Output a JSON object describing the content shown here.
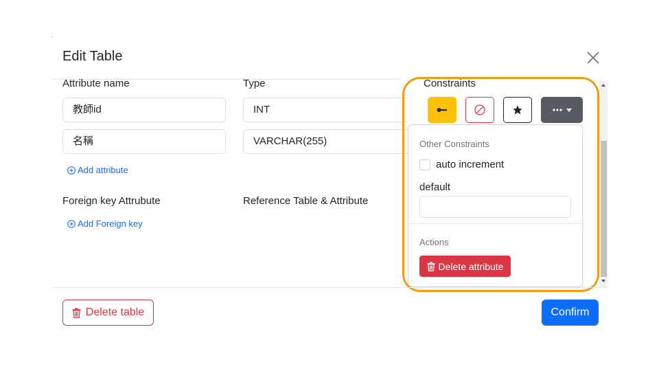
{
  "modal": {
    "title": "Edit Table",
    "close_icon": "close-icon"
  },
  "columns": {
    "attribute_name": "Attribute name",
    "type": "Type",
    "constraints": "Constraints"
  },
  "attributes": [
    {
      "name": "教師id",
      "type": "INT"
    },
    {
      "name": "名稱",
      "type": "VARCHAR(255)"
    }
  ],
  "add_attribute": "Add attribute",
  "foreign": {
    "label": "Foreign key Attrubute",
    "reference_label": "Reference Table & Attribute",
    "add_label": "Add Foreign key"
  },
  "constraint_buttons": {
    "primary_key_icon": "key-icon",
    "not_null_icon": "ban-icon",
    "unique_icon": "star-icon",
    "more_icon": "ellipsis-icon"
  },
  "dropdown": {
    "other_constraints_label": "Other Constraints",
    "auto_increment_label": "auto increment",
    "auto_increment_checked": false,
    "default_label": "default",
    "default_value": "",
    "actions_label": "Actions",
    "delete_attribute_label": "Delete attribute"
  },
  "footer": {
    "delete_table_label": "Delete table",
    "confirm_label": "Confirm"
  },
  "colors": {
    "primary": "#0d6efd",
    "danger": "#dc3545",
    "warning": "#ffc107",
    "secondary": "#555b61",
    "highlight": "#f39c12"
  }
}
